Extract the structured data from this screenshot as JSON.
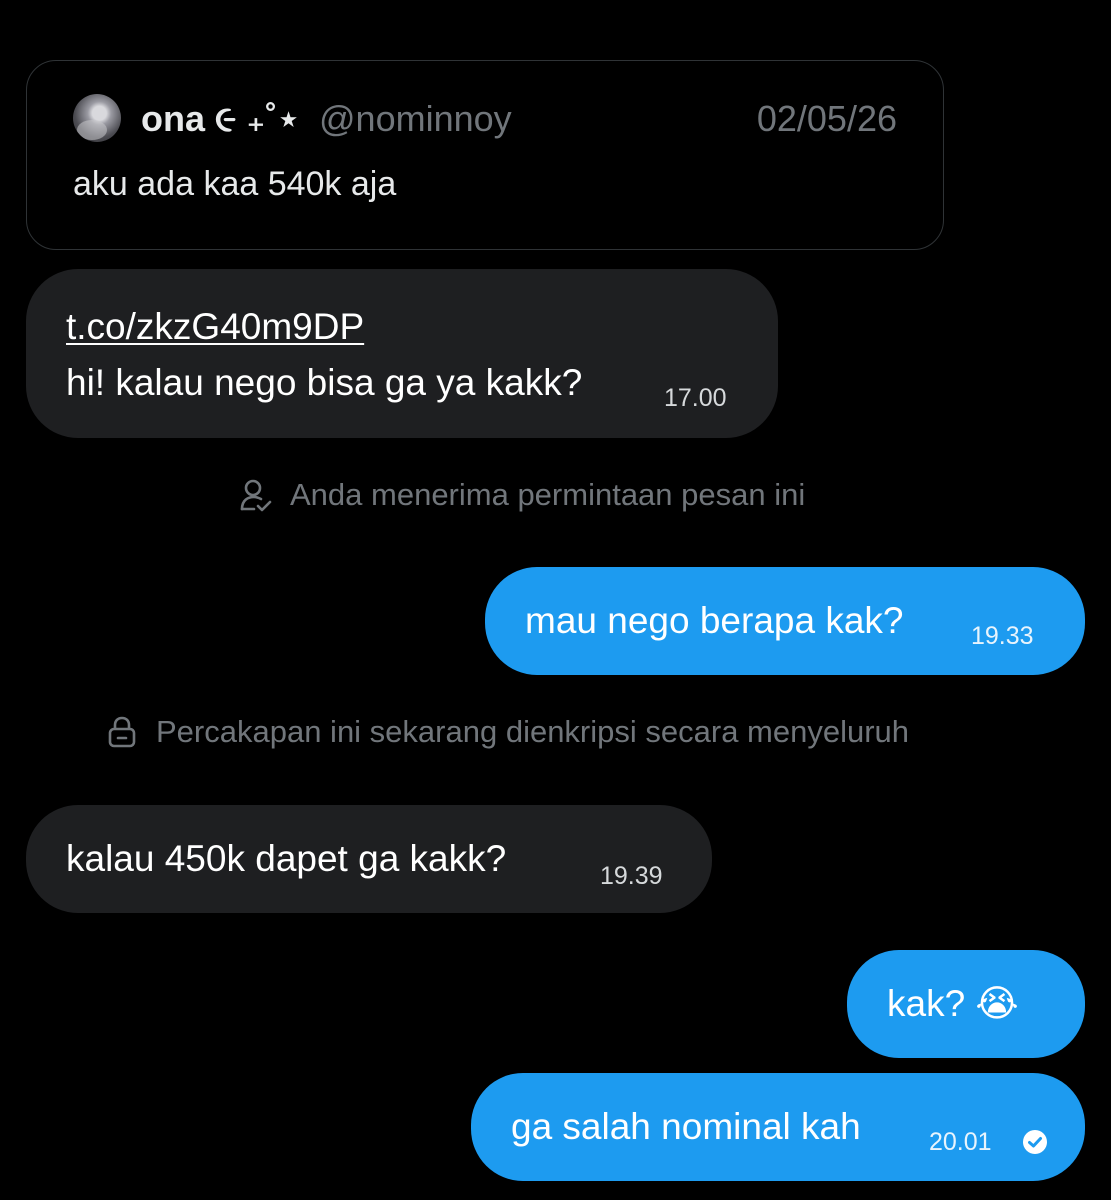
{
  "quote": {
    "name": "ona ૯ ₊˚⋆",
    "handle": "@nominnoy",
    "date": "02/05/26",
    "text": "aku ada kaa 540k aja"
  },
  "messages": [
    {
      "direction": "incoming",
      "link": "t.co/zkzG40m9DP",
      "text": "hi! kalau nego bisa ga ya kakk?",
      "time": "17.00"
    },
    {
      "direction": "outgoing",
      "text": "mau nego berapa kak?",
      "time": "19.33"
    },
    {
      "direction": "incoming",
      "text": "kalau 450k dapet ga kakk?",
      "time": "19.39"
    },
    {
      "direction": "outgoing",
      "text": "kak? 😭"
    },
    {
      "direction": "outgoing",
      "text": "ga salah nominal kah",
      "time": "20.01",
      "status_icon": "read-check-icon"
    }
  ],
  "notices": {
    "request_accepted": "Anda menerima permintaan pesan ini",
    "encrypted": "Percakapan ini sekarang dienkripsi secara menyeluruh"
  },
  "icons": {
    "request_accepted": "person-check-icon",
    "encrypted": "lock-icon"
  },
  "colors": {
    "background": "#000000",
    "incoming_bubble": "#1e1f21",
    "outgoing_bubble": "#1d9bf0",
    "secondary_text": "#71767b"
  }
}
